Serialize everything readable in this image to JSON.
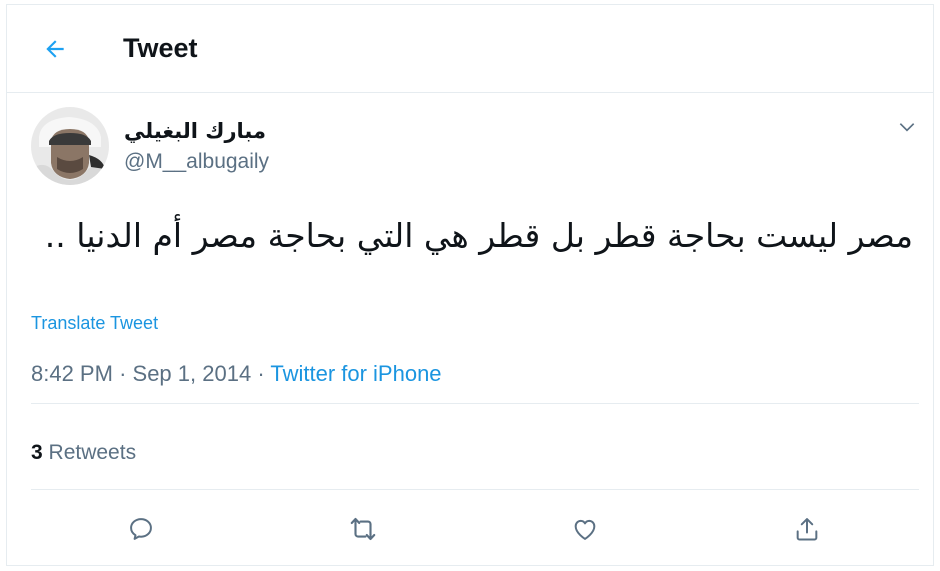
{
  "header": {
    "title": "Tweet",
    "back_icon": "arrow-left-icon"
  },
  "author": {
    "display_name": "مبارك البغيلي",
    "handle": "@M__albugaily",
    "avatar_icon": "user-avatar"
  },
  "tweet": {
    "text": "مصر ليست بحاجة قطر بل قطر هي التي بحاجة مصر أم الدنيا ..",
    "translate_label": "Translate Tweet",
    "time": "8:42 PM",
    "separator": "·",
    "date": "Sep 1, 2014",
    "source": "Twitter for iPhone"
  },
  "stats": {
    "retweets_count": "3",
    "retweets_label": "Retweets"
  },
  "actions": [
    "reply-icon",
    "retweet-icon",
    "like-icon",
    "share-icon"
  ],
  "colors": {
    "accent": "#1b95e0",
    "muted": "#5b7083",
    "border": "#e6ecf0",
    "text": "#0f1419"
  }
}
